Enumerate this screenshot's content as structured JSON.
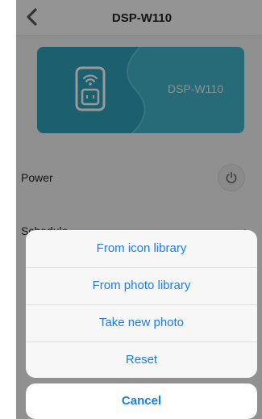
{
  "navbar": {
    "title": "DSP-W110",
    "back_icon": "chevron-left-icon"
  },
  "device_card": {
    "name": "DSP-W110",
    "icon": "smart-plug-icon",
    "color": "#3aa9c1"
  },
  "power": {
    "label": "Power",
    "icon": "power-icon"
  },
  "schedule": {
    "label": "Schedule",
    "icon": "chevron-right-icon"
  },
  "action_sheet": {
    "items": [
      {
        "label": "From icon library"
      },
      {
        "label": "From photo library"
      },
      {
        "label": "Take new photo"
      },
      {
        "label": "Reset"
      }
    ],
    "cancel_label": "Cancel",
    "accent_color": "#1a7cf4"
  }
}
